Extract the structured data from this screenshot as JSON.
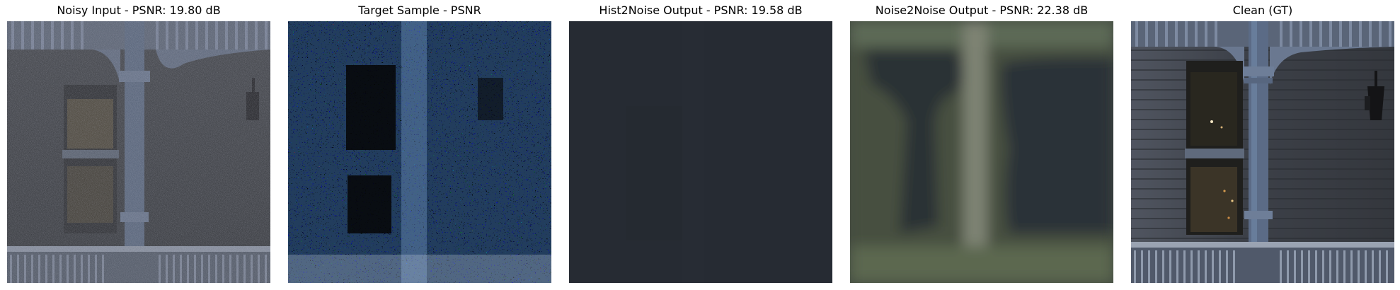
{
  "figure": {
    "panels": [
      {
        "title": "Noisy Input - PSNR:  19.80 dB",
        "image": "noisy-porch-photo"
      },
      {
        "title": "Target Sample - PSNR",
        "image": "high-noise-target-sample"
      },
      {
        "title": "Hist2Noise Output - PSNR:  19.58 dB",
        "image": "dark-flat-output"
      },
      {
        "title": "Noise2Noise Output - PSNR:  22.38 dB",
        "image": "blurred-green-output"
      },
      {
        "title": "Clean (GT)",
        "image": "clean-porch-photo"
      }
    ]
  }
}
